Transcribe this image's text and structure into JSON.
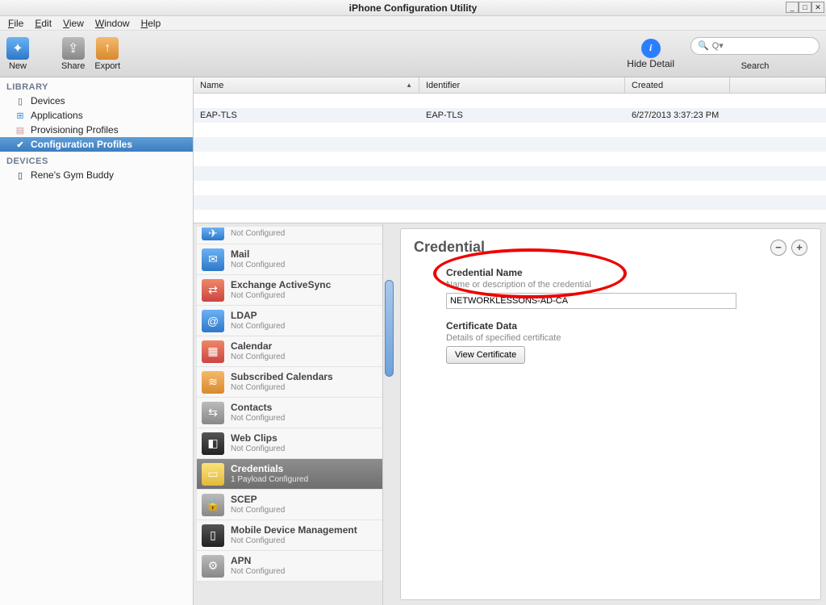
{
  "window": {
    "title": "iPhone Configuration Utility",
    "min": "_",
    "max": "□",
    "close": "✕"
  },
  "menubar": [
    "File",
    "Edit",
    "View",
    "Window",
    "Help"
  ],
  "toolbar": {
    "new": "New",
    "share": "Share",
    "export": "Export",
    "hide_detail": "Hide Detail",
    "search": "Search",
    "search_placeholder": "Q▾"
  },
  "sidebar": {
    "library_header": "LIBRARY",
    "devices_header": "DEVICES",
    "library_items": [
      {
        "label": "Devices",
        "icon": "▯"
      },
      {
        "label": "Applications",
        "icon": "⊞"
      },
      {
        "label": "Provisioning Profiles",
        "icon": "▤"
      },
      {
        "label": "Configuration Profiles",
        "icon": "✔"
      }
    ],
    "device_items": [
      {
        "label": "Rene's Gym Buddy",
        "icon": "▯"
      }
    ]
  },
  "table": {
    "columns": {
      "name": "Name",
      "identifier": "Identifier",
      "created": "Created"
    },
    "rows": [
      {
        "name": "EAP-TLS",
        "identifier": "EAP-TLS",
        "created": "6/27/2013 3:37:23 PM"
      }
    ]
  },
  "payloads": {
    "not_configured": "Not Configured",
    "items": [
      {
        "title": "",
        "sub": "Not Configured",
        "icon": "✈",
        "bg": "bg-blue",
        "partial": true
      },
      {
        "title": "Mail",
        "sub": "Not Configured",
        "icon": "✉",
        "bg": "bg-blue"
      },
      {
        "title": "Exchange ActiveSync",
        "sub": "Not Configured",
        "icon": "⇄",
        "bg": "bg-red"
      },
      {
        "title": "LDAP",
        "sub": "Not Configured",
        "icon": "@",
        "bg": "bg-blue"
      },
      {
        "title": "Calendar",
        "sub": "Not Configured",
        "icon": "▦",
        "bg": "bg-red"
      },
      {
        "title": "Subscribed Calendars",
        "sub": "Not Configured",
        "icon": "≋",
        "bg": "bg-orange"
      },
      {
        "title": "Contacts",
        "sub": "Not Configured",
        "icon": "⇆",
        "bg": "bg-gray"
      },
      {
        "title": "Web Clips",
        "sub": "Not Configured",
        "icon": "◧",
        "bg": "bg-dark"
      },
      {
        "title": "Credentials",
        "sub": "1 Payload Configured",
        "icon": "▭",
        "bg": "bg-yellow",
        "selected": true
      },
      {
        "title": "SCEP",
        "sub": "Not Configured",
        "icon": "🔒",
        "bg": "bg-gray"
      },
      {
        "title": "Mobile Device Management",
        "sub": "Not Configured",
        "icon": "▯",
        "bg": "bg-dark"
      },
      {
        "title": "APN",
        "sub": "Not Configured",
        "icon": "⚙",
        "bg": "bg-gray"
      }
    ]
  },
  "detail": {
    "title": "Credential",
    "cred_name_label": "Credential Name",
    "cred_name_help": "Name or description of the credential",
    "cred_name_value": "NETWORKLESSONS-AD-CA",
    "cert_data_label": "Certificate Data",
    "cert_data_help": "Details of specified certificate",
    "view_cert": "View Certificate",
    "minus": "−",
    "plus": "+"
  }
}
